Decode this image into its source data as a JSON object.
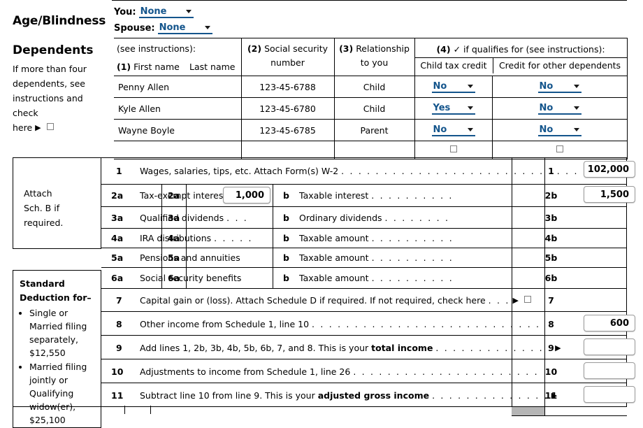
{
  "age_blindness": {
    "section_label": "Age/Blindness",
    "you_label": "You:",
    "you_value": "None",
    "spouse_label": "Spouse:",
    "spouse_value": "None"
  },
  "dependents": {
    "title": "Dependents",
    "note_line1": "If more than four",
    "note_line2": "dependents, see",
    "note_line3": "instructions and check",
    "note_line4": "here",
    "headers": {
      "see_instructions": "(see instructions):",
      "col1_num": "(1)",
      "col1_first": "First name",
      "col1_last": "Last name",
      "col2_num": "(2)",
      "col2_line1": "Social security",
      "col2_line2": "number",
      "col3_num": "(3)",
      "col3_line1": "Relationship",
      "col3_line2": "to you",
      "col4_num": "(4)",
      "col4_check": "✓ if qualifies for (see instructions):",
      "col4_a": "Child tax credit",
      "col4_b": "Credit for other dependents"
    },
    "rows": [
      {
        "name": "Penny Allen",
        "ssn": "123-45-6788",
        "relationship": "Child",
        "child_tax_credit": "No",
        "other_dependents": "No"
      },
      {
        "name": "Kyle Allen",
        "ssn": "123-45-6780",
        "relationship": "Child",
        "child_tax_credit": "Yes",
        "other_dependents": "No"
      },
      {
        "name": "Wayne Boyle",
        "ssn": "123-45-6785",
        "relationship": "Parent",
        "child_tax_credit": "No",
        "other_dependents": "No"
      },
      {
        "name": "",
        "ssn": "",
        "relationship": "",
        "child_tax_credit": "",
        "other_dependents": ""
      }
    ]
  },
  "attach_box": {
    "line1": "Attach",
    "line2": "Sch. B if",
    "line3": "required."
  },
  "standard_deduction": {
    "heading_line1": "Standard",
    "heading_line2": "Deduction for–",
    "bullets": [
      "Single or Married filing separately, $12,550",
      "Married filing jointly or Qualifying widow(er), $25,100"
    ]
  },
  "income": {
    "lines": [
      {
        "no": "1",
        "text": "Wages, salaries, tips, etc. Attach Form(s) W-2",
        "dots": ". . . . . . . . . . . . . . . . . . . . . . . . . . . . .",
        "right_label": "1",
        "value": "102,000"
      },
      {
        "no": "2a",
        "text": "Tax-exempt interest",
        "dots": ". .",
        "mid_label": "2a",
        "mid_value": "1,000",
        "sub_letter": "b",
        "sub_text": "Taxable interest",
        "sub_dots": ". . . . . . . . . .",
        "right_label": "2b",
        "value": "1,500"
      },
      {
        "no": "3a",
        "text": "Qualified dividends",
        "dots": ". . .",
        "mid_label": "3a",
        "mid_value": "",
        "sub_letter": "b",
        "sub_text": "Ordinary dividends",
        "sub_dots": ". . . . . . . .",
        "right_label": "3b",
        "value": ""
      },
      {
        "no": "4a",
        "text": "IRA distributions",
        "dots": ". . . . .",
        "mid_label": "4a",
        "mid_value": "",
        "sub_letter": "b",
        "sub_text": "Taxable amount",
        "sub_dots": ". . . . . . . . . .",
        "right_label": "4b",
        "value": ""
      },
      {
        "no": "5a",
        "text": "Pensions and annuities",
        "dots": "",
        "mid_label": "5a",
        "mid_value": "",
        "sub_letter": "b",
        "sub_text": "Taxable amount",
        "sub_dots": ". . . . . . . . . .",
        "right_label": "5b",
        "value": ""
      },
      {
        "no": "6a",
        "text": "Social security benefits",
        "dots": "",
        "mid_label": "6a",
        "mid_value": "",
        "sub_letter": "b",
        "sub_text": "Taxable amount",
        "sub_dots": ". . . . . . . . . .",
        "right_label": "6b",
        "value": ""
      },
      {
        "no": "7",
        "text": "Capital gain or (loss). Attach Schedule D if required. If not required, check here",
        "dots": ". . .",
        "right_label": "7",
        "value": "",
        "has_checkbox": true
      },
      {
        "no": "8",
        "text": "Other income from Schedule 1, line 10",
        "dots": ". . . . . . . . . . . . . . . . . . . . . . . . . . .",
        "right_label": "8",
        "value": "600"
      },
      {
        "no": "9",
        "text_pre": "Add lines 1, 2b, 3b, 4b, 5b, 6b, 7, and 8. This is your ",
        "text_bold": "total income",
        "dots": ". . . . . . . . . . . . . .",
        "right_label": "9",
        "value": ""
      },
      {
        "no": "10",
        "text": "Adjustments to income from Schedule 1, line 26",
        "dots": ". . . . . . . . . . . . . . . . . . . . . .",
        "right_label": "10",
        "value": ""
      },
      {
        "no": "11",
        "text_pre": "Subtract line 10 from line 9. This is your ",
        "text_bold": "adjusted gross income",
        "dots": ". . . . . . . . . . . . . .",
        "right_label": "11",
        "value": ""
      }
    ],
    "arrow_glyph": "▶"
  },
  "colors": {
    "link_blue": "#14558c",
    "border_black": "#000000",
    "field_border": "#9a9a9a",
    "grey_cell": "#b5b5b5"
  }
}
